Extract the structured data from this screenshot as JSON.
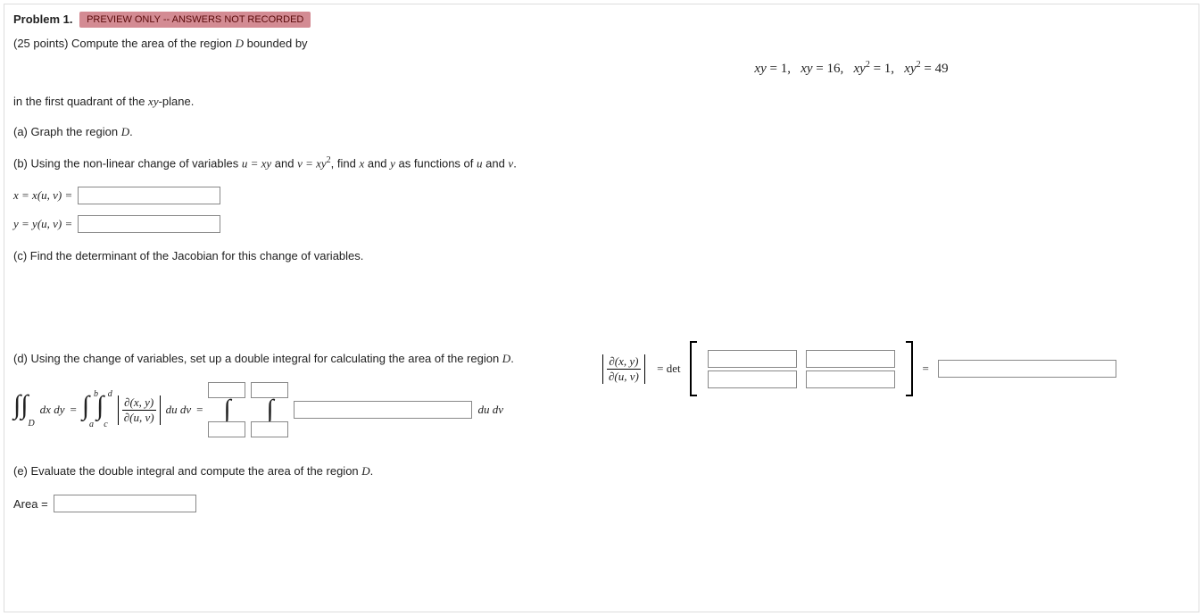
{
  "header": {
    "problem_label": "Problem 1.",
    "badge": "PREVIEW ONLY -- ANSWERS NOT RECORDED"
  },
  "points_line_prefix": "(25 points) Compute the area of the region ",
  "points_line_var": "D",
  "points_line_suffix": " bounded by",
  "equations_center": "xy = 1, xy = 16, xy² = 1, xy² = 49",
  "line_quadrant_prefix": "in the first quadrant of the ",
  "line_quadrant_var": "xy",
  "line_quadrant_suffix": "-plane.",
  "part_a": "(a) Graph the region ",
  "part_a_var": "D",
  "part_a_suffix": ".",
  "part_b_prefix": "(b) Using the non-linear change of variables ",
  "part_b_u": "u = xy",
  "part_b_mid": " and ",
  "part_b_v": "v = xy²",
  "part_b_suffix": ", find ",
  "part_b_x": "x",
  "part_b_and": " and ",
  "part_b_y": "y",
  "part_b_end": " as functions of ",
  "part_b_uu": "u",
  "part_b_and2": " and ",
  "part_b_vv": "v",
  "part_b_dot": ".",
  "x_label": "x = x(u, v) =",
  "y_label": "y = y(u, v) =",
  "part_c": "(c) Find the determinant of the Jacobian for this change of variables.",
  "jac_num": "∂(x, y)",
  "jac_den": "∂(u, v)",
  "eq_det": "= det",
  "eq_sign": "=",
  "part_d": "(d) Using the change of variables, set up a double integral for calculating the area of the region ",
  "part_d_var": "D",
  "part_d_dot": ".",
  "d_lhs_sub": "D",
  "d_lhs_dxdy": "dx dy",
  "d_eq": "=",
  "d_int_a": "a",
  "d_int_b": "b",
  "d_int_c": "c",
  "d_int_d": "d",
  "d_dudv": "du dv",
  "part_e": "(e) Evaluate the double integral and compute the area of the region ",
  "part_e_var": "D",
  "part_e_dot": ".",
  "area_label": "Area ="
}
